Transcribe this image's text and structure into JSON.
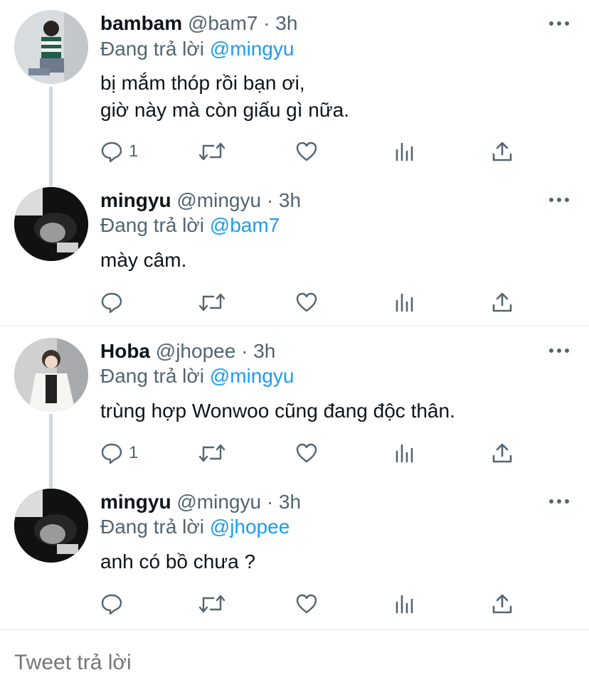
{
  "tweets": [
    {
      "name": "bambam",
      "handle": "@bam7",
      "dot": "·",
      "time": "3h",
      "reply_prefix": "Đang trả lời",
      "reply_to": "@mingyu",
      "text": "bị mắm thóp rồi bạn ơi,\ngiờ này mà còn giấu gì nữa.",
      "reply_count": "1",
      "avatar": "avatar-bambam"
    },
    {
      "name": "mingyu",
      "handle": "@mingyu",
      "dot": "·",
      "time": "3h",
      "reply_prefix": "Đang trả lời",
      "reply_to": "@bam7",
      "text": "mày câm.",
      "reply_count": "",
      "avatar": "avatar-mingyu"
    },
    {
      "name": "Hoba",
      "handle": "@jhopee",
      "dot": "·",
      "time": "3h",
      "reply_prefix": "Đang trả lời",
      "reply_to": "@mingyu",
      "text": "trùng hợp Wonwoo cũng đang độc thân.",
      "reply_count": "1",
      "avatar": "avatar-hoba"
    },
    {
      "name": "mingyu",
      "handle": "@mingyu",
      "dot": "·",
      "time": "3h",
      "reply_prefix": "Đang trả lời",
      "reply_to": "@jhopee",
      "text": "anh có bồ chưa ?",
      "reply_count": "",
      "avatar": "avatar-mingyu"
    }
  ],
  "reply_box": {
    "placeholder": "Tweet trả lời"
  },
  "icons": [
    "reply-icon",
    "retweet-icon",
    "like-icon",
    "views-icon",
    "share-icon",
    "more-icon"
  ],
  "colors": {
    "mention": "#1d9bf0",
    "secondary_text": "#536471",
    "thread_line": "#cfd9de"
  }
}
